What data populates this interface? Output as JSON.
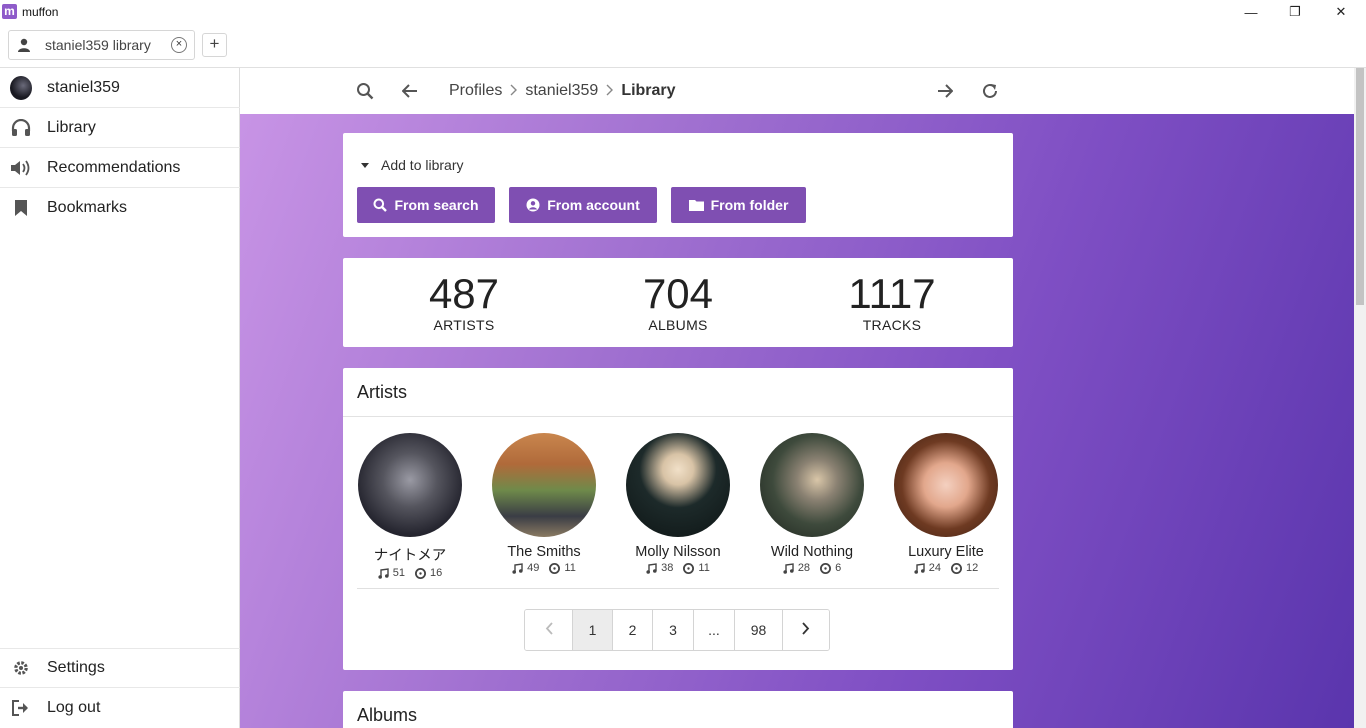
{
  "window": {
    "app_title": "muffon",
    "logo_letter": "m",
    "minimize": "—",
    "maximize": "❐",
    "close": "✕"
  },
  "tabs": [
    {
      "label": "staniel359 library",
      "close": "×"
    }
  ],
  "tab_add": "+",
  "sidebar": {
    "profile": "staniel359",
    "items": [
      {
        "label": "Library",
        "icon": "headphones-icon"
      },
      {
        "label": "Recommendations",
        "icon": "speaker-icon"
      },
      {
        "label": "Bookmarks",
        "icon": "bookmark-icon"
      }
    ],
    "settings": "Settings",
    "logout": "Log out"
  },
  "breadcrumb": [
    "Profiles",
    "staniel359",
    "Library"
  ],
  "add_to_library": {
    "toggle": "Add to library",
    "buttons": [
      "From search",
      "From account",
      "From folder"
    ]
  },
  "stats": [
    {
      "value": "487",
      "label": "ARTISTS"
    },
    {
      "value": "704",
      "label": "ALBUMS"
    },
    {
      "value": "1117",
      "label": "TRACKS"
    }
  ],
  "artists_section": {
    "title": "Artists",
    "artists": [
      {
        "name": "ナイトメア",
        "tracks": "51",
        "albums": "16"
      },
      {
        "name": "The Smiths",
        "tracks": "49",
        "albums": "11"
      },
      {
        "name": "Molly Nilsson",
        "tracks": "38",
        "albums": "11"
      },
      {
        "name": "Wild Nothing",
        "tracks": "28",
        "albums": "6"
      },
      {
        "name": "Luxury Elite",
        "tracks": "24",
        "albums": "12"
      }
    ]
  },
  "pagination": {
    "prev": "‹",
    "pages": [
      "1",
      "2",
      "3",
      "...",
      "98"
    ],
    "current": "1",
    "next": "›"
  },
  "albums_section": {
    "title": "Albums"
  },
  "colors": {
    "accent": "#7f4fb2",
    "gradient_start": "#c995e6",
    "gradient_end": "#5a35ad"
  }
}
